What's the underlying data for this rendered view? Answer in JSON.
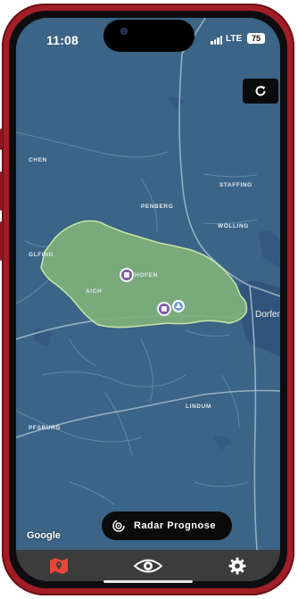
{
  "status_bar": {
    "time": "11:08",
    "network": "LTE",
    "battery": "75"
  },
  "map": {
    "places": {
      "chen": "CHEN",
      "staffing": "STAFFING",
      "penberg": "PENBERG",
      "wolling": "WÖLLING",
      "glfing": "GLFING",
      "hofen": "HOFEN",
      "aich": "AICH",
      "dorfen": "Dorfen",
      "lindum": "LINDUM",
      "pfsburg": "PFSBURG"
    },
    "attribution": "Google",
    "region_color": "#7fb07c"
  },
  "actions": {
    "refresh_icon": "refresh-icon",
    "radar_button_label": "Radar Prognose"
  },
  "tab_bar": {
    "items": [
      {
        "icon": "map-pin-icon",
        "color": "#e8463a",
        "active": true
      },
      {
        "icon": "eye-icon",
        "color": "#ffffff",
        "active": false
      },
      {
        "icon": "gear-icon",
        "color": "#ffffff",
        "active": false
      }
    ]
  }
}
